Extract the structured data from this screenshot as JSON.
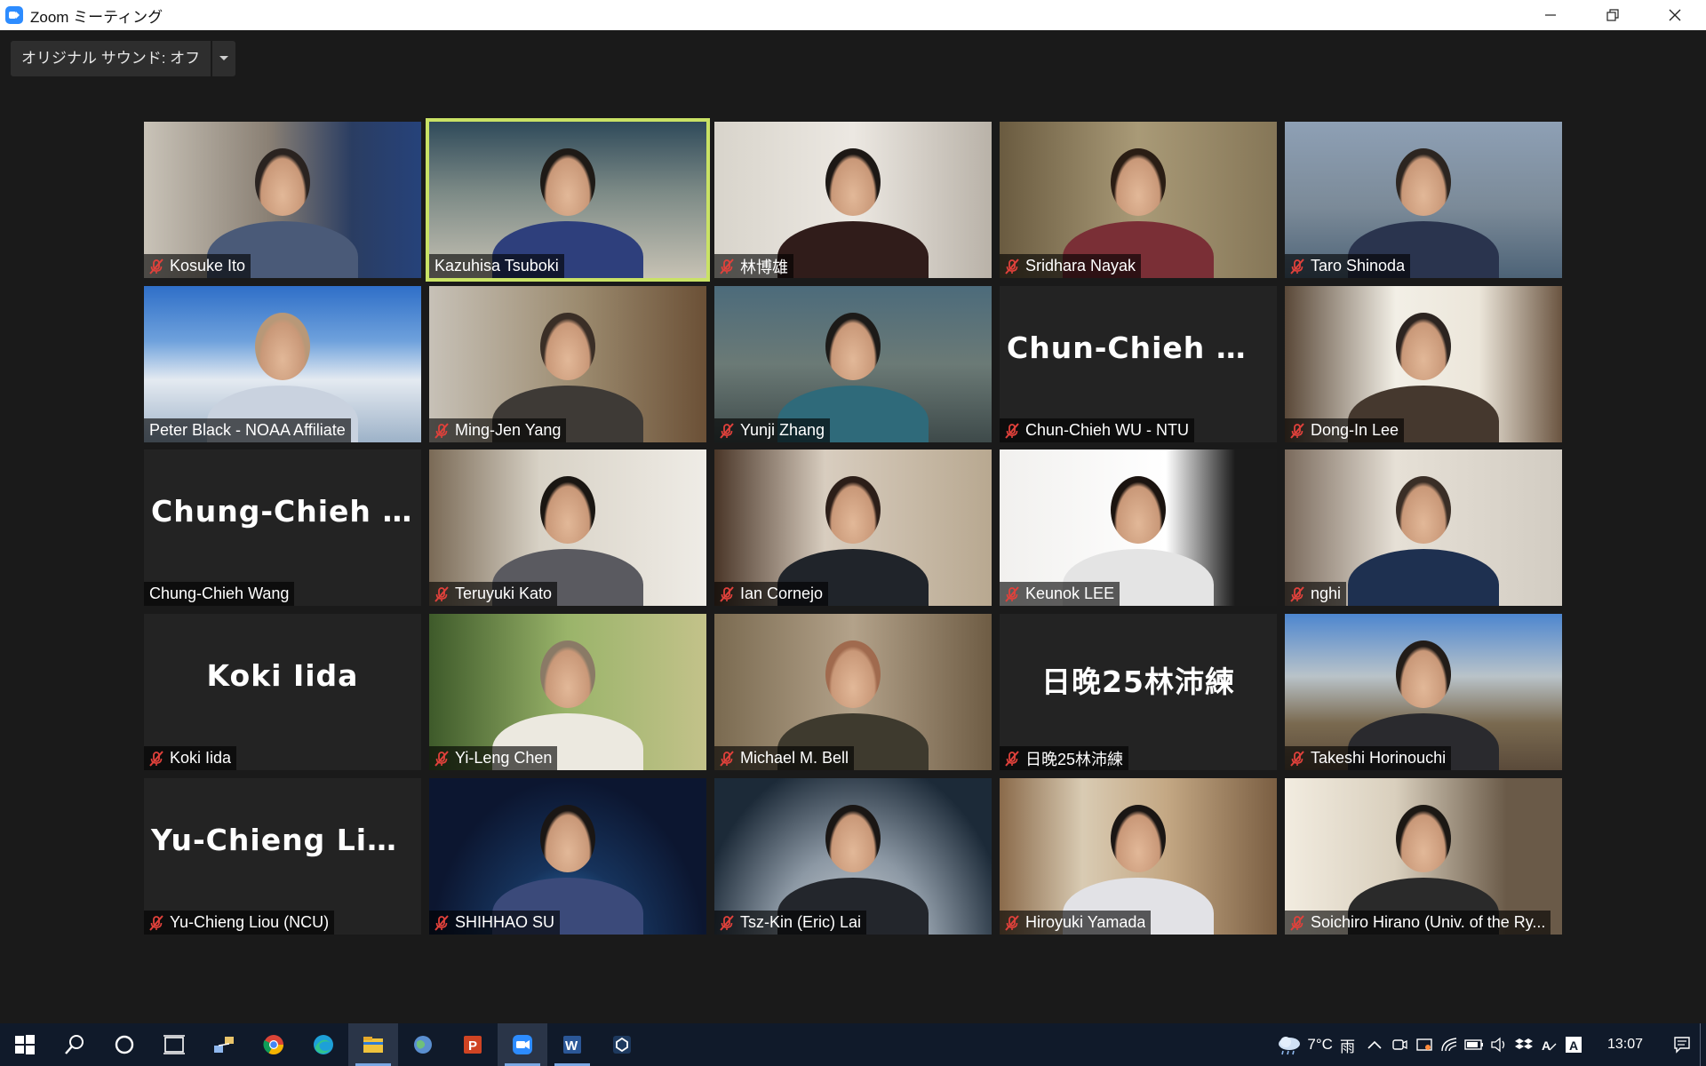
{
  "window": {
    "title": "Zoom ミーティング"
  },
  "original_sound": {
    "label": "オリジナル サウンド: オフ"
  },
  "participants": [
    {
      "name": "Kosuke Ito",
      "muted": true,
      "video": true
    },
    {
      "name": "Kazuhisa Tsuboki",
      "muted": false,
      "video": true,
      "active_speaker": true
    },
    {
      "name": "林博雄",
      "muted": true,
      "video": true
    },
    {
      "name": "Sridhara Nayak",
      "muted": true,
      "video": true
    },
    {
      "name": "Taro Shinoda",
      "muted": true,
      "video": true
    },
    {
      "name": "Peter Black - NOAA Affiliate",
      "muted": false,
      "video": true
    },
    {
      "name": "Ming-Jen Yang",
      "muted": true,
      "video": true
    },
    {
      "name": "Yunji Zhang",
      "muted": true,
      "video": true
    },
    {
      "name": "Chun-Chieh WU - NTU",
      "muted": true,
      "video": false,
      "display": "Chun-Chieh  WU..."
    },
    {
      "name": "Dong-In Lee",
      "muted": true,
      "video": true
    },
    {
      "name": "Chung-Chieh Wang",
      "muted": false,
      "video": false,
      "display": "Chung-Chieh  W..."
    },
    {
      "name": "Teruyuki Kato",
      "muted": true,
      "video": true
    },
    {
      "name": "Ian Cornejo",
      "muted": true,
      "video": true
    },
    {
      "name": "Keunok LEE",
      "muted": true,
      "video": true
    },
    {
      "name": "nghi",
      "muted": true,
      "video": true
    },
    {
      "name": "Koki Iida",
      "muted": true,
      "video": false,
      "display": "Koki Iida"
    },
    {
      "name": "Yi-Leng Chen",
      "muted": true,
      "video": true
    },
    {
      "name": "Michael M. Bell",
      "muted": true,
      "video": true
    },
    {
      "name": "日晚25林沛練",
      "muted": true,
      "video": false,
      "display": "日晚25林沛練"
    },
    {
      "name": "Takeshi Horinouchi",
      "muted": true,
      "video": true
    },
    {
      "name": "Yu-Chieng Liou (NCU)",
      "muted": true,
      "video": false,
      "display": "Yu-Chieng  Liou..."
    },
    {
      "name": "SHIHHAO SU",
      "muted": true,
      "video": true
    },
    {
      "name": "Tsz-Kin (Eric) Lai",
      "muted": true,
      "video": true
    },
    {
      "name": "Hiroyuki Yamada",
      "muted": true,
      "video": true
    },
    {
      "name": "Soichiro Hirano (Univ. of the Ry...",
      "muted": true,
      "video": true
    }
  ],
  "taskbar": {
    "apps": [
      "start-icon",
      "search-icon",
      "cortana-icon",
      "task-view-icon",
      "network-tool-icon",
      "chrome-icon",
      "edge-icon",
      "file-explorer-icon",
      "globe-app-icon",
      "powerpoint-icon",
      "zoom-icon",
      "word-icon",
      "app-icon"
    ],
    "weather": {
      "temp": "7°C",
      "condition": "雨"
    },
    "clock": "13:07"
  }
}
